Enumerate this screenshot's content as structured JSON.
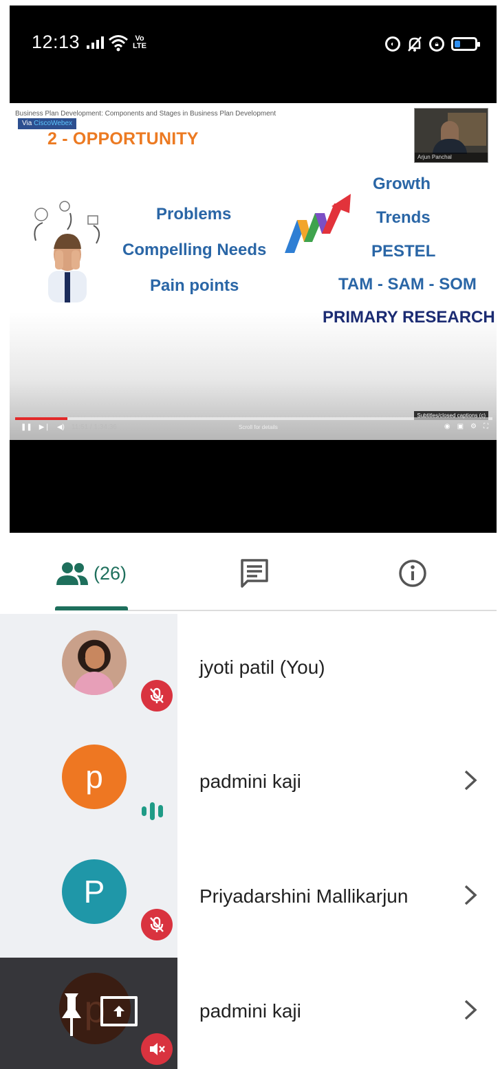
{
  "status_bar": {
    "time": "12:13",
    "volte_top": "Vo",
    "volte_bottom": "LTE",
    "battery_level": 0.3,
    "battery_color": "#2f8ff0"
  },
  "video": {
    "title": "Business Plan Development: Components and Stages in Business Plan Development",
    "via_prefix": "Via ",
    "via_brand": "CiscoWebex",
    "presenter_name": "Arjun Panchal",
    "slide_heading": "2 - OPPORTUNITY",
    "left_terms": [
      "Problems",
      "Compelling Needs",
      "Pain points"
    ],
    "right_terms": [
      "Growth",
      "Trends",
      "PESTEL",
      "TAM - SAM - SOM"
    ],
    "primary_term": "PRIMARY RESEARCH",
    "progress": 0.11,
    "progress_color": "#e22a2a",
    "time_display": "11:51 / 1:34:36",
    "scroll_hint": "Scroll for details",
    "captions_tooltip": "Subtitles/closed captions (c)",
    "heading_color": "#ec7a22",
    "term_color": "#2a66a6",
    "primary_color": "#1b2b72"
  },
  "tabs": {
    "participants_count": "(26)",
    "active_tab": "participants",
    "accent": "#1e6f5c"
  },
  "participants": [
    {
      "name": "jyoti patil (You)",
      "avatar": "photo",
      "status": "muted",
      "has_chevron": false
    },
    {
      "name": "padmini kaji",
      "initial": "p",
      "avatar_color": "#ee7722",
      "status": "speaking",
      "has_chevron": true
    },
    {
      "name": "Priyadarshini Mallikarjun",
      "initial": "P",
      "avatar_color": "#1f97a8",
      "status": "muted",
      "has_chevron": true
    },
    {
      "name": "padmini kaji",
      "initial": "p",
      "avatar": "self-view",
      "status": "audio-muted",
      "has_chevron": true
    }
  ],
  "colors": {
    "muted_badge": "#d9333f",
    "speaking": "#1f9b86"
  }
}
